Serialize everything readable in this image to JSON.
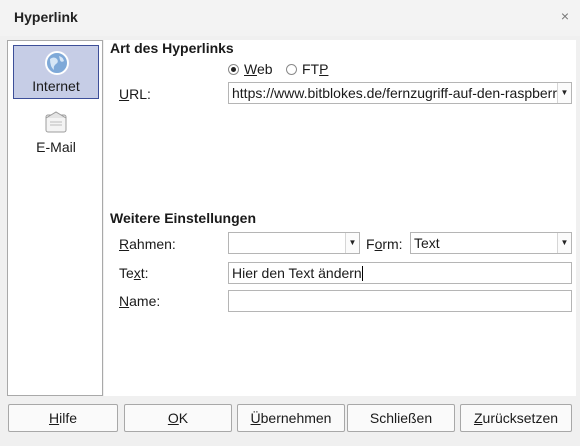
{
  "window": {
    "title": "Hyperlink",
    "close_glyph": "×",
    "close_icon": "close-icon"
  },
  "sidebar": {
    "items": [
      {
        "label": "Internet",
        "icon": "globe-icon",
        "selected": true
      },
      {
        "label": "E-Mail",
        "icon": "mail-icon",
        "selected": false
      }
    ]
  },
  "hyperlink_type": {
    "heading": "Art des Hyperlinks",
    "options": [
      {
        "label_u": "W",
        "label_rest": "eb",
        "selected": true
      },
      {
        "label_pre": "FT",
        "label_u": "P",
        "selected": false
      }
    ],
    "url_label_u": "U",
    "url_label_rest": "RL:",
    "url_value": "https://www.bitblokes.de/fernzugriff-auf-den-raspberry"
  },
  "further_settings": {
    "heading": "Weitere Einstellungen",
    "frame_label_u": "R",
    "frame_label_rest": "ahmen:",
    "frame_value": "",
    "form_label_pre": "F",
    "form_label_u": "o",
    "form_label_rest": "rm:",
    "form_value": "Text",
    "text_label_pre": "Te",
    "text_label_u": "x",
    "text_label_rest": "t:",
    "text_value": "Hier den Text ändern",
    "name_label_u": "N",
    "name_label_rest": "ame:",
    "name_value": ""
  },
  "buttons": {
    "help_u": "H",
    "help_rest": "ilfe",
    "ok_u": "O",
    "ok_rest": "K",
    "apply_u": "Ü",
    "apply_rest": "bernehmen",
    "close": "Schließen",
    "reset_u": "Z",
    "reset_rest": "urücksetzen"
  },
  "colors": {
    "selection_bg": "#c6cde6",
    "selection_border": "#3d4f99"
  }
}
